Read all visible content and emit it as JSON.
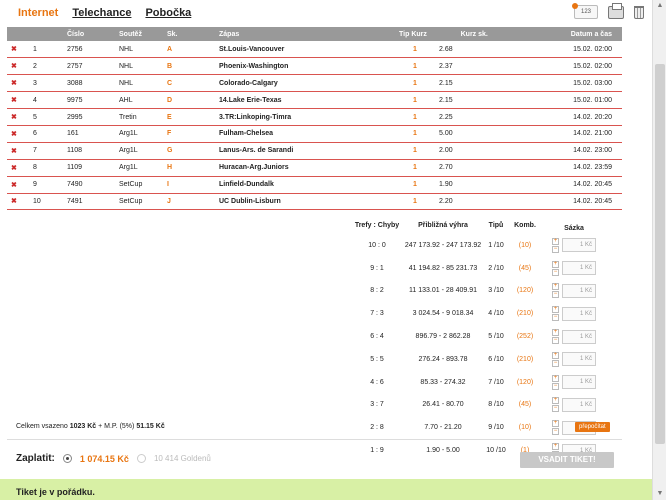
{
  "tabs": [
    {
      "label": "Internet",
      "active": true
    },
    {
      "label": "Telechance",
      "active": false
    },
    {
      "label": "Pobočka",
      "active": false
    }
  ],
  "top_icons": {
    "badge": "123",
    "print": "print-icon",
    "delete": "trash-icon"
  },
  "bets_table": {
    "headers": [
      "",
      "",
      "Číslo",
      "Soutěž",
      "Sk.",
      "Zápas",
      "Tip Kurz",
      "",
      "Kurz sk.",
      "Datum a čas"
    ],
    "rows": [
      {
        "n": "1",
        "cislo": "2756",
        "soutez": "NHL",
        "sk": "A",
        "zapas": "St.Louis-Vancouver",
        "tip": "1",
        "kurz": "2.68",
        "datum": "15.02. 02:00"
      },
      {
        "n": "2",
        "cislo": "2757",
        "soutez": "NHL",
        "sk": "B",
        "zapas": "Phoenix-Washington",
        "tip": "1",
        "kurz": "2.37",
        "datum": "15.02. 02:00"
      },
      {
        "n": "3",
        "cislo": "3088",
        "soutez": "NHL",
        "sk": "C",
        "zapas": "Colorado-Calgary",
        "tip": "1",
        "kurz": "2.15",
        "datum": "15.02. 03:00"
      },
      {
        "n": "4",
        "cislo": "9975",
        "soutez": "AHL",
        "sk": "D",
        "zapas": "14.Lake Erie-Texas",
        "tip": "1",
        "kurz": "2.15",
        "datum": "15.02. 01:00"
      },
      {
        "n": "5",
        "cislo": "2995",
        "soutez": "Tretin",
        "sk": "E",
        "zapas": "3.TR:Linkoping-Timra",
        "tip": "1",
        "kurz": "2.25",
        "datum": "14.02. 20:20"
      },
      {
        "n": "6",
        "cislo": "161",
        "soutez": "Arg1L",
        "sk": "F",
        "zapas": "Fulham-Chelsea",
        "tip": "1",
        "kurz": "5.00",
        "datum": "14.02. 21:00"
      },
      {
        "n": "7",
        "cislo": "1108",
        "soutez": "Arg1L",
        "sk": "G",
        "zapas": "Lanus-Ars. de Sarandi",
        "tip": "1",
        "kurz": "2.00",
        "datum": "14.02. 23:00"
      },
      {
        "n": "8",
        "cislo": "1109",
        "soutez": "Arg1L",
        "sk": "H",
        "zapas": "Huracan-Arg.Juniors",
        "tip": "1",
        "kurz": "2.70",
        "datum": "14.02. 23:59"
      },
      {
        "n": "9",
        "cislo": "7490",
        "soutez": "SetCup",
        "sk": "I",
        "zapas": "Linfield-Dundalk",
        "tip": "1",
        "kurz": "1.90",
        "datum": "14.02. 20:45"
      },
      {
        "n": "10",
        "cislo": "7491",
        "soutez": "SetCup",
        "sk": "J",
        "zapas": "UC Dublin-Lisburn",
        "tip": "1",
        "kurz": "2.20",
        "datum": "14.02. 20:45"
      }
    ]
  },
  "system": {
    "headers": [
      "Trefy : Chyby",
      "Přibližná výhra",
      "Tipů",
      "Komb.",
      "Sázka"
    ],
    "rows": [
      {
        "trefy": "10 : 0",
        "vyhra": "247 173.92 - 247 173.92",
        "tipu": "1 /10",
        "komb": "(10)",
        "sazka": "1 Kč"
      },
      {
        "trefy": "9 : 1",
        "vyhra": "41 194.82 - 85 231.73",
        "tipu": "2 /10",
        "komb": "(45)",
        "sazka": "1 Kč"
      },
      {
        "trefy": "8 : 2",
        "vyhra": "11 133.01 - 28 409.91",
        "tipu": "3 /10",
        "komb": "(120)",
        "sazka": "1 Kč"
      },
      {
        "trefy": "7 : 3",
        "vyhra": "3 024.54 - 9 018.34",
        "tipu": "4 /10",
        "komb": "(210)",
        "sazka": "1 Kč"
      },
      {
        "trefy": "6 : 4",
        "vyhra": "896.79 - 2 862.28",
        "tipu": "5 /10",
        "komb": "(252)",
        "sazka": "1 Kč"
      },
      {
        "trefy": "5 : 5",
        "vyhra": "276.24 - 893.78",
        "tipu": "6 /10",
        "komb": "(210)",
        "sazka": "1 Kč"
      },
      {
        "trefy": "4 : 6",
        "vyhra": "85.33 - 274.32",
        "tipu": "7 /10",
        "komb": "(120)",
        "sazka": "1 Kč"
      },
      {
        "trefy": "3 : 7",
        "vyhra": "26.41 - 80.70",
        "tipu": "8 /10",
        "komb": "(45)",
        "sazka": "1 Kč"
      },
      {
        "trefy": "2 : 8",
        "vyhra": "7.70 - 21.20",
        "tipu": "9 /10",
        "komb": "(10)",
        "sazka": "1 Kč"
      },
      {
        "trefy": "1 : 9",
        "vyhra": "1.90 - 5.00",
        "tipu": "10 /10",
        "komb": "(1)",
        "sazka": "1 Kč"
      }
    ]
  },
  "summary": {
    "prefix": "Celkem vsazeno ",
    "amount": "1023 Kč",
    "mid": " + M.P. (5%) ",
    "fee": "51.15 Kč",
    "recalc_label": "přepočítat"
  },
  "payment": {
    "label": "Zaplatit:",
    "option1": "1 074.15 Kč",
    "option2": "10 414 Goldenů",
    "submit_label": "VSADIT TIKET!"
  },
  "status": {
    "text": "Tiket je v pořádku."
  },
  "colors": {
    "accent": "#e87511",
    "row_border": "#d9534f",
    "header_bg": "#999999",
    "status_bg": "#d8f0a5"
  }
}
